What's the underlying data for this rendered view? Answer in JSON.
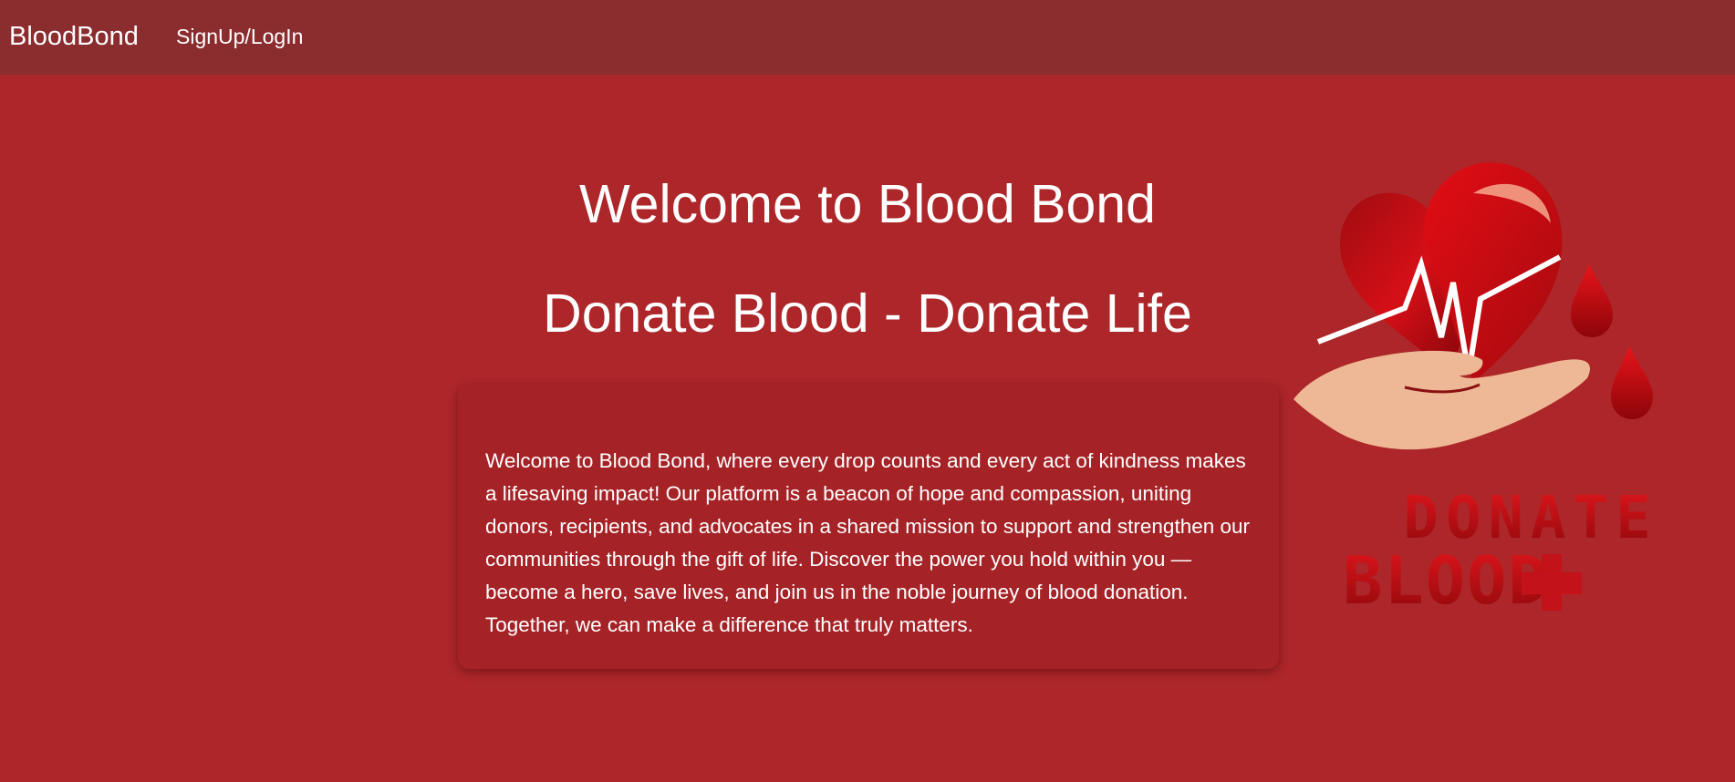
{
  "navbar": {
    "brand": "BloodBond",
    "links": [
      {
        "label": "SignUp/LogIn"
      }
    ]
  },
  "hero": {
    "title": "Welcome to Blood Bond",
    "subtitle": "Donate Blood - Donate Life"
  },
  "card": {
    "text": "Welcome to Blood Bond, where every drop counts and every act of kindness makes a lifesaving impact! Our platform is a beacon of hope and compassion, uniting donors, recipients, and advocates in a shared mission to support and strengthen our communities through the gift of life. Discover the power you hold within you — become a hero, save lives, and join us in the noble journey of blood donation. Together, we can make a difference that truly matters."
  },
  "logo": {
    "line1": "DONATE",
    "line2": "BLOOD"
  },
  "colors": {
    "background": "#ad2629",
    "navbar": "#8b2c2f",
    "card": "#a52327",
    "heart": "#d90f17",
    "hand": "#eeb896"
  }
}
